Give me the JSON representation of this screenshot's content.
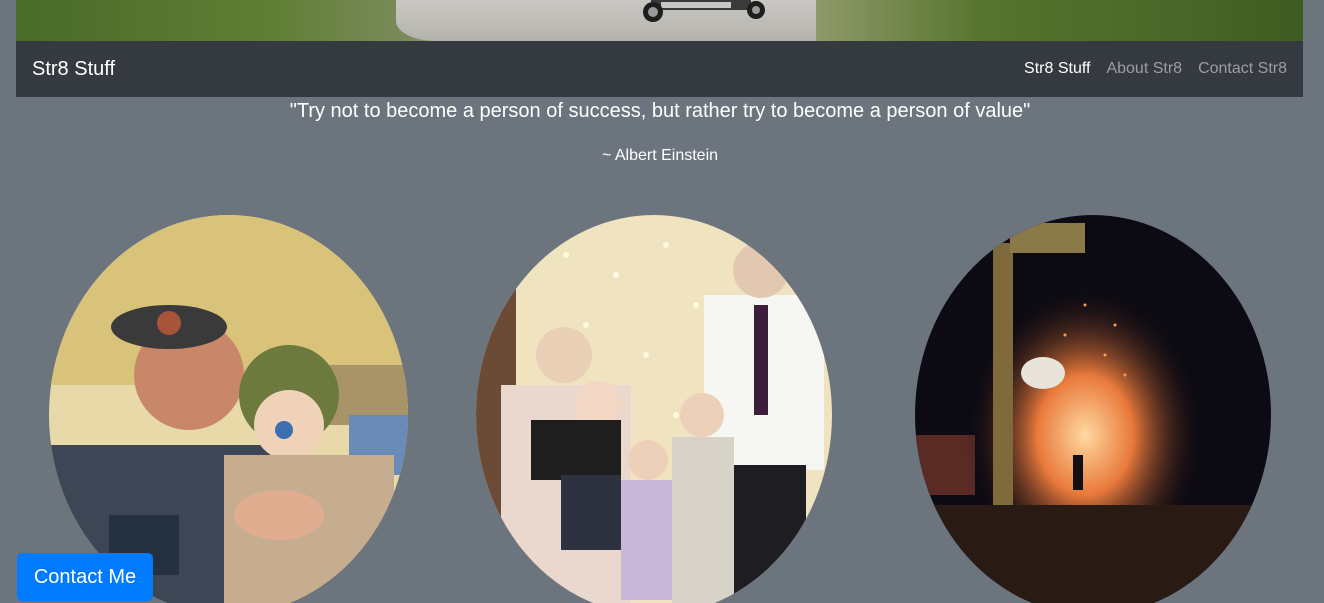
{
  "navbar": {
    "brand": "Str8 Stuff",
    "links": [
      {
        "label": "Str8 Stuff",
        "active": true
      },
      {
        "label": "About Str8",
        "active": false
      },
      {
        "label": "Contact Str8",
        "active": false
      }
    ]
  },
  "quote": {
    "text": "\"Try not to become a person of success, but rather try to become a person of value\"",
    "author": "~ Albert Einstein"
  },
  "photos": [
    {
      "subject": "man-with-baby-photo"
    },
    {
      "subject": "family-children-photo"
    },
    {
      "subject": "night-fire-sparks-photo"
    }
  ],
  "contact_button": {
    "label": "Contact Me"
  },
  "colors": {
    "page_bg": "#6c757d",
    "navbar_bg": "#343a40",
    "button_bg": "#007bff"
  }
}
